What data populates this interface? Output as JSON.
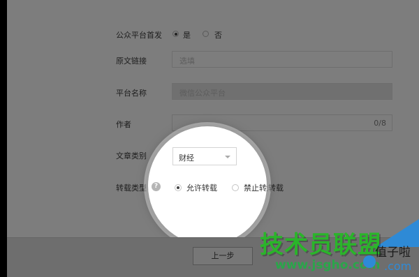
{
  "form": {
    "first_publish": {
      "label": "公众平台首发",
      "options": [
        "是",
        "否"
      ],
      "selected": "是"
    },
    "original_link": {
      "label": "原文链接",
      "placeholder": "选填"
    },
    "platform_name": {
      "label": "平台名称",
      "value": "微信公众平台"
    },
    "author": {
      "label": "作者",
      "counter": "0/8"
    },
    "category": {
      "label": "文章类别",
      "value": "财经"
    },
    "repost_type": {
      "label": "转载类型",
      "options": [
        "允许转载",
        "禁止转载"
      ],
      "selected": "允许转载"
    }
  },
  "footer": {
    "prev_label": "上一步"
  },
  "watermark": {
    "title": "技术员联盟",
    "url": "www.jsgho.com",
    "brand": "值子啦",
    "brand_domain": ".com"
  },
  "icons": {
    "help": "question-icon",
    "dropdown": "chevron-down-icon",
    "smile": "smile-icon"
  },
  "colors": {
    "overlay": "#7d7d7d",
    "watermark_green": "#2ab52a",
    "watermark_blue": "#2e8ad6"
  }
}
